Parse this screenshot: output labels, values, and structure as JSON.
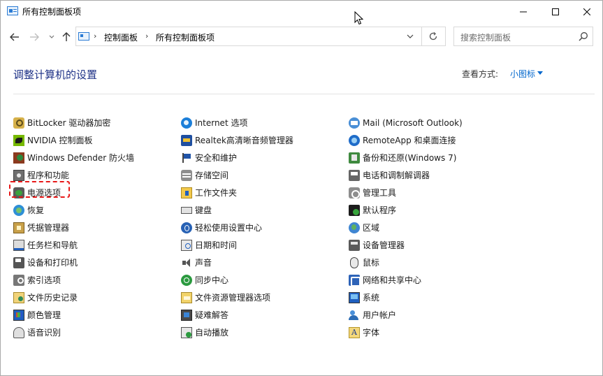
{
  "window": {
    "title": "所有控制面板项"
  },
  "nav": {
    "breadcrumb": [
      "控制面板",
      "所有控制面板项"
    ],
    "search_placeholder": "搜索控制面板"
  },
  "header": {
    "heading": "调整计算机的设置",
    "view_by_label": "查看方式:",
    "view_by_value": "小图标"
  },
  "items": {
    "col1": [
      {
        "label": "BitLocker 驱动器加密",
        "icon": "bitlocker-icon"
      },
      {
        "label": "NVIDIA 控制面板",
        "icon": "nvidia-icon"
      },
      {
        "label": "Windows Defender 防火墙",
        "icon": "firewall-icon"
      },
      {
        "label": "程序和功能",
        "icon": "programs-icon"
      },
      {
        "label": "电源选项",
        "icon": "power-icon"
      },
      {
        "label": "恢复",
        "icon": "recovery-icon"
      },
      {
        "label": "凭据管理器",
        "icon": "credential-icon"
      },
      {
        "label": "任务栏和导航",
        "icon": "taskbar-icon"
      },
      {
        "label": "设备和打印机",
        "icon": "printer-icon"
      },
      {
        "label": "索引选项",
        "icon": "indexing-icon"
      },
      {
        "label": "文件历史记录",
        "icon": "file-history-icon"
      },
      {
        "label": "颜色管理",
        "icon": "color-management-icon"
      },
      {
        "label": "语音识别",
        "icon": "speech-icon"
      }
    ],
    "col2": [
      {
        "label": "Internet 选项",
        "icon": "internet-options-icon"
      },
      {
        "label": "Realtek高清晰音频管理器",
        "icon": "realtek-icon"
      },
      {
        "label": "安全和维护",
        "icon": "security-flag-icon"
      },
      {
        "label": "存储空间",
        "icon": "storage-icon"
      },
      {
        "label": "工作文件夹",
        "icon": "work-folders-icon"
      },
      {
        "label": "键盘",
        "icon": "keyboard-icon"
      },
      {
        "label": "轻松使用设置中心",
        "icon": "ease-of-access-icon"
      },
      {
        "label": "日期和时间",
        "icon": "date-time-icon"
      },
      {
        "label": "声音",
        "icon": "sound-icon"
      },
      {
        "label": "同步中心",
        "icon": "sync-icon"
      },
      {
        "label": "文件资源管理器选项",
        "icon": "explorer-options-icon"
      },
      {
        "label": "疑难解答",
        "icon": "troubleshooting-icon"
      },
      {
        "label": "自动播放",
        "icon": "autoplay-icon"
      }
    ],
    "col3": [
      {
        "label": "Mail (Microsoft Outlook)",
        "icon": "mail-icon"
      },
      {
        "label": "RemoteApp 和桌面连接",
        "icon": "remoteapp-icon"
      },
      {
        "label": "备份和还原(Windows 7)",
        "icon": "backup-icon"
      },
      {
        "label": "电话和调制解调器",
        "icon": "phone-modem-icon"
      },
      {
        "label": "管理工具",
        "icon": "admin-tools-icon"
      },
      {
        "label": "默认程序",
        "icon": "default-programs-icon"
      },
      {
        "label": "区域",
        "icon": "region-icon"
      },
      {
        "label": "设备管理器",
        "icon": "device-manager-icon"
      },
      {
        "label": "鼠标",
        "icon": "mouse-icon"
      },
      {
        "label": "网络和共享中心",
        "icon": "network-icon"
      },
      {
        "label": "系统",
        "icon": "system-icon"
      },
      {
        "label": "用户帐户",
        "icon": "user-accounts-icon"
      },
      {
        "label": "字体",
        "icon": "fonts-icon"
      }
    ]
  },
  "highlighted_item": "电源选项",
  "colors": {
    "heading": "#1e3287",
    "link": "#0066cc",
    "highlight_border": "#e81818"
  }
}
